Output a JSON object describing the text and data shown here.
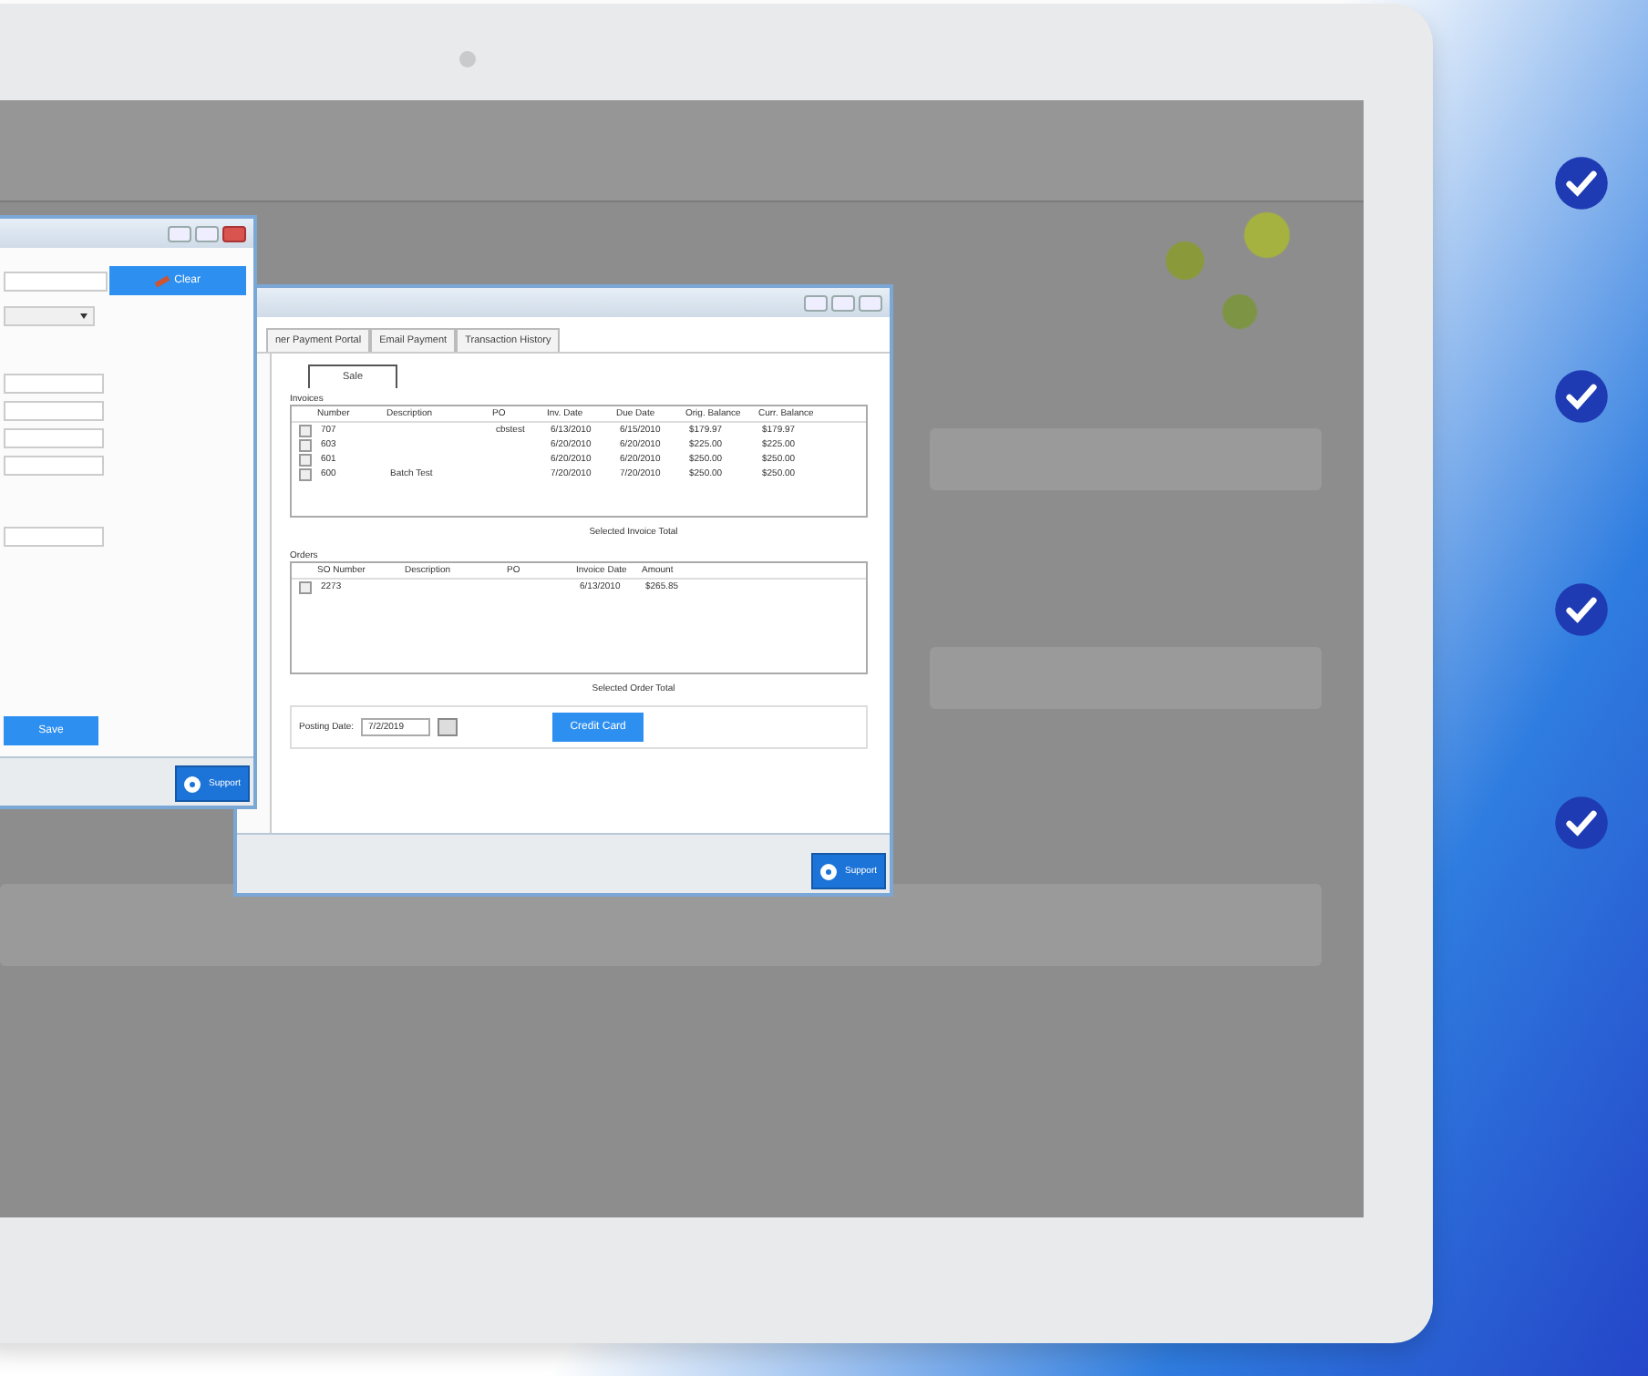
{
  "left_dialog": {
    "clear_button": "Clear",
    "save_button": "Save",
    "support_button": "Support"
  },
  "payment_window": {
    "tabs": [
      {
        "label": "ner Payment Portal",
        "selected": false
      },
      {
        "label": "Email Payment",
        "selected": false
      },
      {
        "label": "Transaction History",
        "selected": false
      }
    ],
    "sub_tabs": [
      {
        "label": "Sale",
        "selected": true
      }
    ],
    "invoices": {
      "title": "Invoices",
      "columns": [
        "Number",
        "Description",
        "PO",
        "Inv. Date",
        "Due Date",
        "Orig. Balance",
        "Curr. Balance"
      ],
      "rows": [
        {
          "checked": false,
          "cells": [
            "707",
            null,
            "cbstest",
            "6/13/2010",
            "6/15/2010",
            "$179.97",
            "$179.97"
          ]
        },
        {
          "checked": false,
          "cells": [
            "603",
            null,
            null,
            "6/20/2010",
            "6/20/2010",
            "$225.00",
            "$225.00"
          ]
        },
        {
          "checked": false,
          "cells": [
            "601",
            null,
            null,
            "6/20/2010",
            "6/20/2010",
            "$250.00",
            "$250.00"
          ]
        },
        {
          "checked": false,
          "cells": [
            "600",
            "Batch Test",
            null,
            "7/20/2010",
            "7/20/2010",
            "$250.00",
            "$250.00"
          ]
        }
      ]
    },
    "invoice_total_label": "Selected Invoice Total",
    "orders": {
      "title": "Orders",
      "columns": [
        "SO Number",
        "Description",
        "PO",
        "Invoice Date",
        "Amount"
      ],
      "rows": [
        {
          "checked": false,
          "cells": [
            "2273",
            null,
            null,
            "6/13/2010",
            "$265.85"
          ]
        }
      ]
    },
    "order_total_label": "Selected Order Total",
    "posting_date": {
      "label": "Posting Date:",
      "value": "7/2/2019"
    },
    "credit_card_button": "Credit Card",
    "support_button": "Support"
  }
}
